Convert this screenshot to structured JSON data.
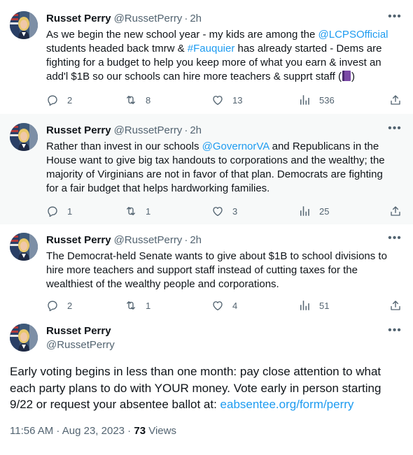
{
  "thread": [
    {
      "name": "Russet Perry",
      "handle": "@RussetPerry",
      "separator": "·",
      "time": "2h",
      "text_parts": {
        "p1": "As we begin the new school year - my kids are among the ",
        "m1": "@LCPSOfficial",
        "p2": " students headed back tmrw & ",
        "m2": "#Fauquier",
        "p3": " has already started - Dems are fighting for a budget to help you keep more of what you earn & invest an add'l $1B so our schools can hire more teachers & supprt staff (",
        "p4": ")"
      },
      "replies": "2",
      "retweets": "8",
      "likes": "13",
      "views": "536"
    },
    {
      "name": "Russet Perry",
      "handle": "@RussetPerry",
      "separator": "·",
      "time": "2h",
      "text_parts": {
        "p1": "Rather than invest in our schools ",
        "m1": "@GovernorVA",
        "p2": " and Republicans in the House want to give big tax handouts to corporations and the wealthy; the majority of Virginians are not in favor of that plan. Democrats are fighting for a fair budget that helps hardworking families."
      },
      "replies": "1",
      "retweets": "1",
      "likes": "3",
      "views": "25"
    },
    {
      "name": "Russet Perry",
      "handle": "@RussetPerry",
      "separator": "·",
      "time": "2h",
      "text": "The Democrat-held Senate wants to give about $1B to school divisions to hire more teachers and support staff instead of cutting taxes for the wealthiest of the wealthy people and corporations.",
      "replies": "2",
      "retweets": "1",
      "likes": "4",
      "views": "51"
    }
  ],
  "main": {
    "name": "Russet Perry",
    "handle": "@RussetPerry",
    "text": "Early voting begins in less than one month: pay close attention to what each party plans to do with YOUR money. Vote early in person starting 9/22 or request your absentee ballot at: ",
    "link": "eabsentee.org/form/perry",
    "timestamp": "11:56 AM · Aug 23, 2023",
    "separator": " · ",
    "views_count": "73",
    "views_label": " Views"
  },
  "icons": {
    "more": "more-icon",
    "reply": "reply-icon",
    "retweet": "retweet-icon",
    "like": "heart-icon",
    "views": "views-icon",
    "share": "share-icon",
    "book": "purple-book-emoji"
  },
  "colors": {
    "link": "#1d9bf0",
    "muted": "#536471",
    "text": "#0f1419",
    "highlight_bg": "#f7f9f9"
  }
}
